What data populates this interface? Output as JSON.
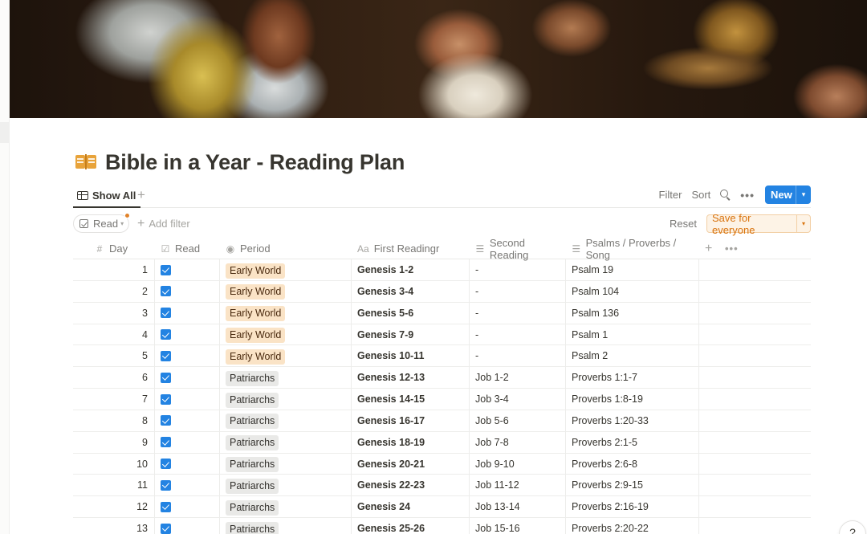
{
  "page": {
    "title": "Bible in a Year - Reading Plan",
    "icon": "open-book-icon"
  },
  "views": {
    "tabs": [
      {
        "label": "Show All",
        "icon": "table-icon"
      }
    ],
    "add_label": "+"
  },
  "toolbar": {
    "filter_label": "Filter",
    "sort_label": "Sort",
    "more_label": "•••",
    "new_label": "New",
    "new_chevron": "▾"
  },
  "filters": {
    "chip_label": "Read",
    "chip_chevron": "▾",
    "add_filter_label": "Add filter",
    "add_filter_plus": "+",
    "reset_label": "Reset",
    "save_label": "Save for everyone",
    "save_chevron": "▾"
  },
  "colors": {
    "accent": "#2383e2",
    "save_text": "#d9730d",
    "early_world_tag": "#fae3c6",
    "patriarchs_tag": "#e9e9e7",
    "filter_dot": "#e0822a"
  },
  "columns": [
    {
      "label": "Day",
      "icon": "#"
    },
    {
      "label": "Read",
      "icon": "☑"
    },
    {
      "label": "Period",
      "icon": "◉"
    },
    {
      "label": "First Readingr",
      "icon": "Aa"
    },
    {
      "label": "Second Reading",
      "icon": "☰"
    },
    {
      "label": "Psalms / Proverbs / Song",
      "icon": "☰"
    }
  ],
  "header_extras": {
    "add": "+",
    "more": "•••"
  },
  "rows": [
    {
      "day": "1",
      "read": true,
      "period": "Early World",
      "first": "Genesis 1-2",
      "second": "-",
      "psalms": "Psalm 19"
    },
    {
      "day": "2",
      "read": true,
      "period": "Early World",
      "first": "Genesis 3-4",
      "second": "-",
      "psalms": "Psalm 104"
    },
    {
      "day": "3",
      "read": true,
      "period": "Early World",
      "first": "Genesis 5-6",
      "second": "-",
      "psalms": "Psalm 136"
    },
    {
      "day": "4",
      "read": true,
      "period": "Early World",
      "first": "Genesis 7-9",
      "second": "-",
      "psalms": "Psalm 1"
    },
    {
      "day": "5",
      "read": true,
      "period": "Early World",
      "first": "Genesis 10-11",
      "second": "-",
      "psalms": "Psalm 2"
    },
    {
      "day": "6",
      "read": true,
      "period": "Patriarchs",
      "first": "Genesis 12-13",
      "second": "Job 1-2",
      "psalms": "Proverbs 1:1-7"
    },
    {
      "day": "7",
      "read": true,
      "period": "Patriarchs",
      "first": "Genesis 14-15",
      "second": "Job 3-4",
      "psalms": "Proverbs 1:8-19"
    },
    {
      "day": "8",
      "read": true,
      "period": "Patriarchs",
      "first": "Genesis 16-17",
      "second": "Job 5-6",
      "psalms": "Proverbs 1:20-33"
    },
    {
      "day": "9",
      "read": true,
      "period": "Patriarchs",
      "first": "Genesis 18-19",
      "second": "Job 7-8",
      "psalms": "Proverbs 2:1-5"
    },
    {
      "day": "10",
      "read": true,
      "period": "Patriarchs",
      "first": "Genesis 20-21",
      "second": "Job 9-10",
      "psalms": "Proverbs 2:6-8"
    },
    {
      "day": "11",
      "read": true,
      "period": "Patriarchs",
      "first": "Genesis 22-23",
      "second": "Job 11-12",
      "psalms": "Proverbs 2:9-15"
    },
    {
      "day": "12",
      "read": true,
      "period": "Patriarchs",
      "first": "Genesis 24",
      "second": "Job 13-14",
      "psalms": "Proverbs 2:16-19"
    },
    {
      "day": "13",
      "read": true,
      "period": "Patriarchs",
      "first": "Genesis 25-26",
      "second": "Job 15-16",
      "psalms": "Proverbs 2:20-22"
    }
  ],
  "help": {
    "label": "?"
  }
}
